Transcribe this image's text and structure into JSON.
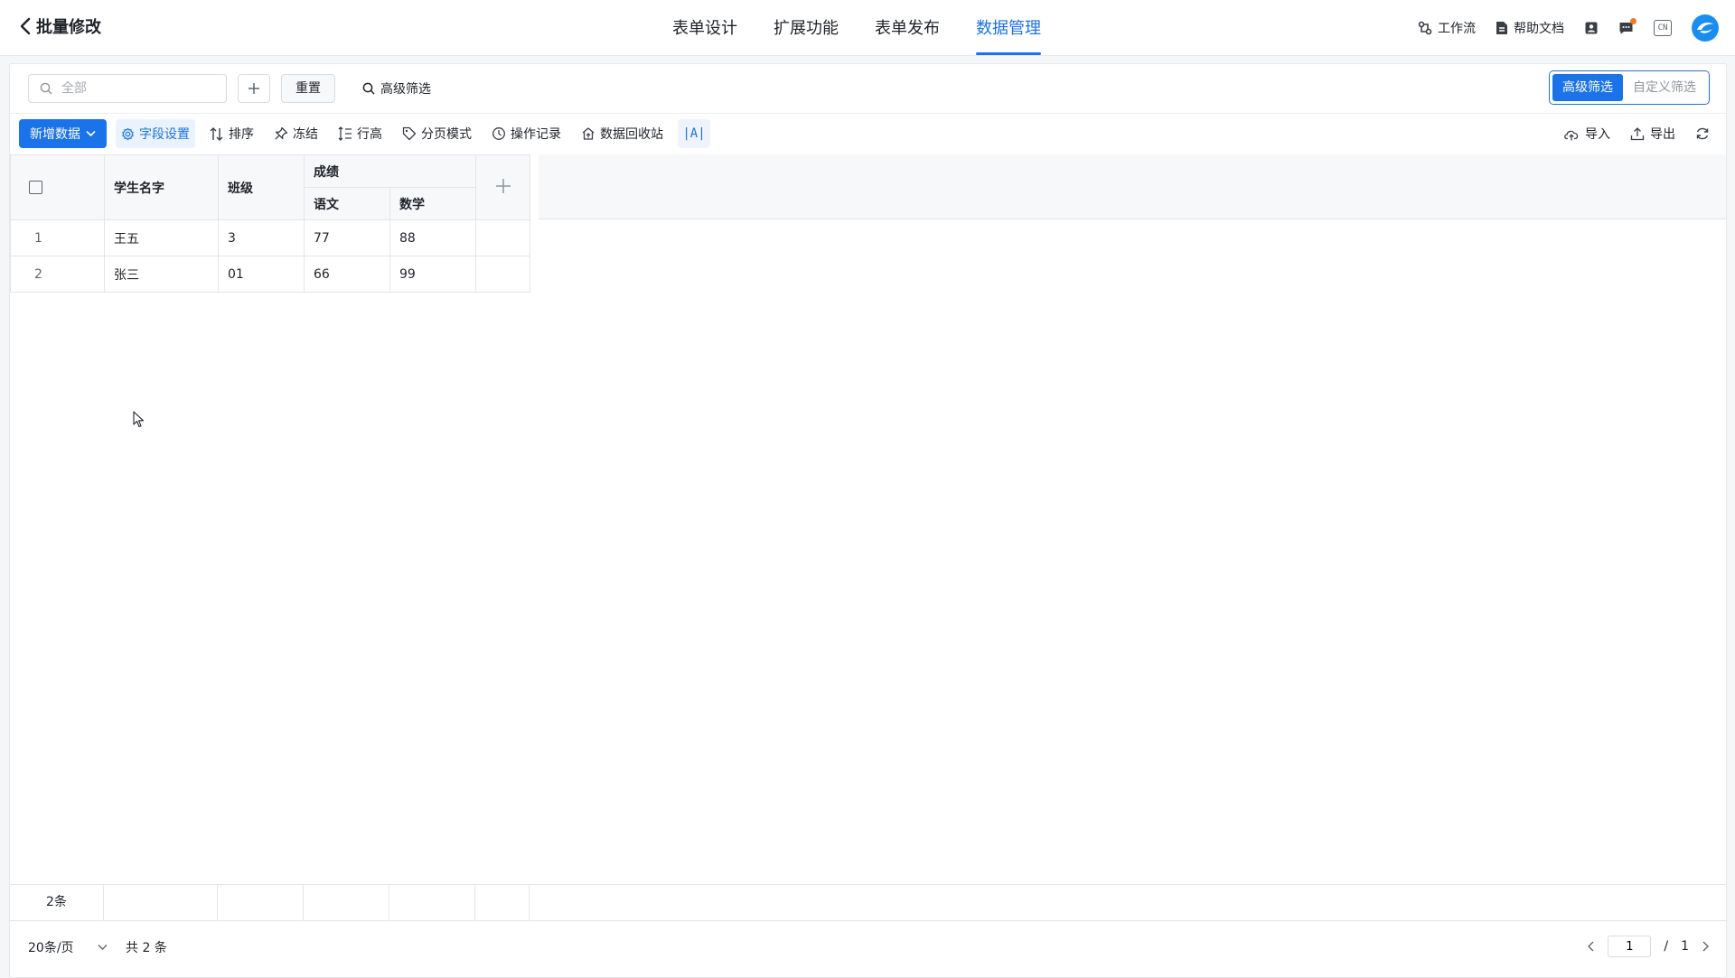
{
  "header": {
    "back_title": "批量修改",
    "tabs": [
      {
        "label": "表单设计",
        "active": false
      },
      {
        "label": "扩展功能",
        "active": false
      },
      {
        "label": "表单发布",
        "active": false
      },
      {
        "label": "数据管理",
        "active": true
      }
    ],
    "workflow_label": "工作流",
    "help_label": "帮助文档",
    "lang_label": "CN",
    "accent": "#1a73e8"
  },
  "filter": {
    "search_placeholder": "全部",
    "reset_label": "重置",
    "advanced_link": "高级筛选",
    "mode_options": [
      "高级筛选",
      "自定义筛选"
    ],
    "mode_active": "高级筛选"
  },
  "toolbar": {
    "add_data": "新增数据",
    "field_settings": "字段设置",
    "sort": "排序",
    "freeze": "冻结",
    "row_height": "行高",
    "paging_mode": "分页模式",
    "op_log": "操作记录",
    "recycle_bin": "数据回收站",
    "text_toggle": "|A|",
    "import": "导入",
    "export": "导出"
  },
  "table": {
    "columns": {
      "name": "学生名字",
      "class": "班级",
      "score_group": "成绩",
      "chinese": "语文",
      "math": "数学"
    },
    "rows": [
      {
        "index": "1",
        "name": "王五",
        "class": "3",
        "chinese": "77",
        "math": "88"
      },
      {
        "index": "2",
        "name": "张三",
        "class": "01",
        "chinese": "66",
        "math": "99"
      }
    ],
    "summary_count": "2条"
  },
  "pagination": {
    "page_size": "20条/页",
    "total": "共 2 条",
    "current_page": "1",
    "separator": "/",
    "total_pages": "1"
  }
}
